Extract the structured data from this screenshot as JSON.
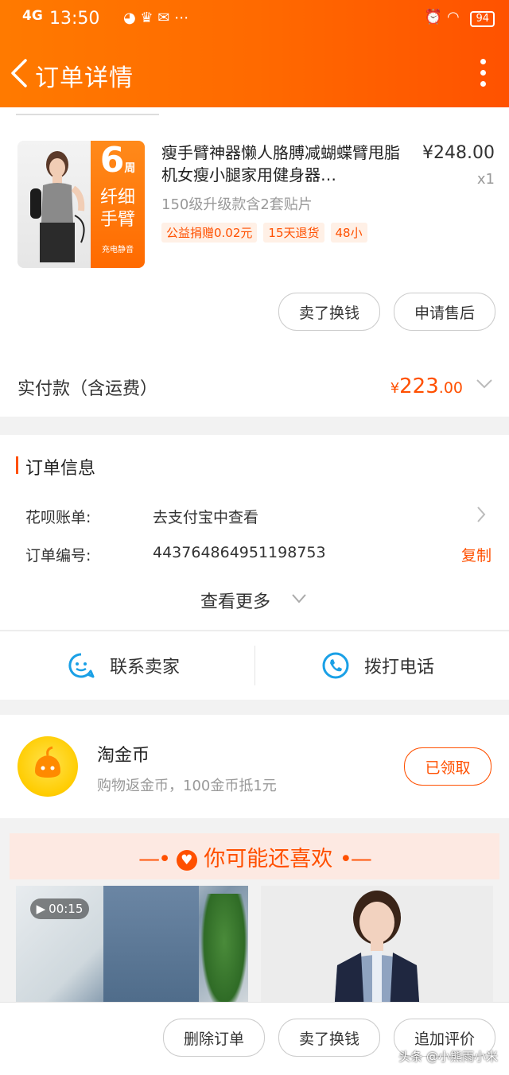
{
  "status_bar": {
    "signal": "4G",
    "time": "13:50",
    "battery": "94"
  },
  "header": {
    "title": "订单详情"
  },
  "product": {
    "name": "瘦手臂神器懒人胳膊减蝴蝶臂甩脂机女瘦小腿家用健身器…",
    "price": "¥248.00",
    "quantity": "x1",
    "spec": "150级升级款含2套贴片",
    "tags": [
      "公益捐赠0.02元",
      "15天退货",
      "48小"
    ],
    "image_text": {
      "big_number": "6",
      "unit": "周",
      "line1": "纤细",
      "line2": "手臂",
      "caption": "充电静音"
    },
    "buttons": {
      "sell": "卖了换钱",
      "after_sale": "申请售后"
    }
  },
  "payment": {
    "label": "实付款（含运费）",
    "currency": "¥",
    "amount_int": "223",
    "amount_dec": ".00"
  },
  "order_info": {
    "title": "订单信息",
    "rows": [
      {
        "label": "花呗账单:",
        "value": "去支付宝中查看"
      },
      {
        "label": "订单编号:",
        "value": "443764864951198753",
        "action": "复制"
      }
    ],
    "see_more": "查看更多"
  },
  "contact": {
    "seller": "联系卖家",
    "phone": "拨打电话"
  },
  "coin": {
    "title": "淘金币",
    "subtitle": "购物返金币，100金币抵1元",
    "button": "已领取"
  },
  "recommend": {
    "title": "你可能还喜欢",
    "video_duration": "00:15"
  },
  "bottom_bar": {
    "delete": "删除订单",
    "sell": "卖了换钱",
    "review": "追加评价"
  },
  "watermark": "头条 @小熊雨小米",
  "colors": {
    "accent": "#ff5000",
    "header": "#ff6a00"
  }
}
